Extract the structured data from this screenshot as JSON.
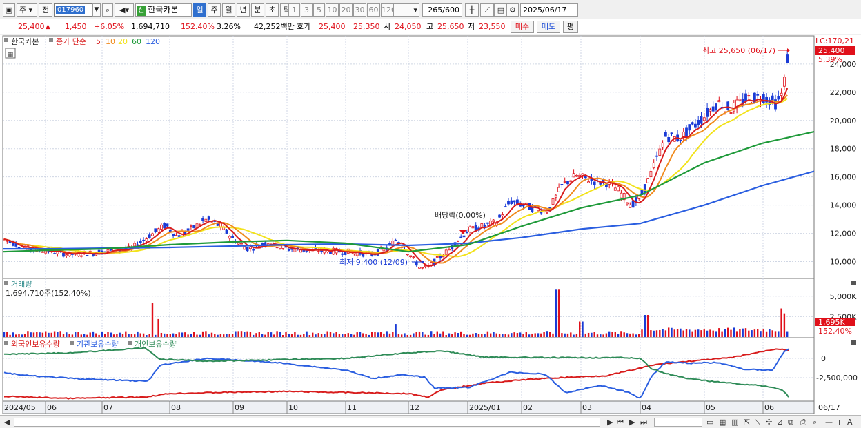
{
  "toolbar": {
    "window_icon": "window-icon",
    "market_label": "주",
    "prev_label": "전",
    "stock_code": "017960",
    "stock_badge": "신",
    "stock_name": "한국카본",
    "periods": [
      "일",
      "주",
      "월",
      "년",
      "분",
      "초",
      "틱"
    ],
    "selected_period": "일",
    "intervals": [
      "1",
      "3",
      "5",
      "10",
      "20",
      "30",
      "60",
      "120"
    ],
    "count_value": "265",
    "count_total": "/600",
    "date_value": "2025/06/17"
  },
  "quote": {
    "price": "25,400",
    "change": "1,450",
    "change_pct": "+6.05%",
    "volume": "1,694,710",
    "volume_ratio": "152.40%",
    "turnover_pct": "3.26%",
    "amount": "42,252백만",
    "ask_label": "호가",
    "ask": "25,400",
    "bid": "25,350",
    "open_label": "시",
    "open": "24,050",
    "high_label": "고",
    "high": "25,650",
    "low_label": "저",
    "low": "23,550",
    "buy_label": "매수",
    "sell_label": "매도",
    "eval_label": "평"
  },
  "price_panel": {
    "stock_name": "한국카본",
    "ma_label": "종가 단순",
    "ma_periods": [
      "5",
      "10",
      "20",
      "60",
      "120"
    ],
    "ma_colors": [
      "#d81c1c",
      "#f08a1c",
      "#f2e21a",
      "#1f9a3a",
      "#2a5ee0"
    ],
    "lc_label": "LC:170,21",
    "last_price_tag": "25,400",
    "pct_tag": "5,39%",
    "y_ticks": [
      "24,000",
      "22,000",
      "20,000",
      "18,000",
      "16,000",
      "14,000",
      "12,000",
      "10,000"
    ],
    "high_note": "최고 25,650 (06/17)",
    "low_note": "최저 9,400 (12/09)",
    "dividend_note": "배당락(0,00%)"
  },
  "volume_panel": {
    "title": "거래량",
    "value_label": "1,694,710주(152,40%)",
    "y_ticks": [
      "5,000K",
      "2,500K"
    ],
    "last_tag": "1,695K",
    "pct_tag": "152,40%"
  },
  "holder_panel": {
    "labels": [
      "외국인보유수량",
      "기관보유수량",
      "개인보유수량"
    ],
    "colors": [
      "#d81c1c",
      "#2a5ee0",
      "#2e8b57"
    ],
    "y_ticks": [
      "0",
      "-2,500,000"
    ]
  },
  "x_axis": [
    "2024/05",
    "06",
    "07",
    "08",
    "09",
    "10",
    "11",
    "12",
    "2025/01",
    "02",
    "03",
    "04",
    "05",
    "06",
    "06/17"
  ],
  "chart_data": {
    "type": "candlestick",
    "x": [
      "2024/05",
      "06",
      "07",
      "08",
      "09",
      "10",
      "11",
      "12",
      "2025/01",
      "02",
      "03",
      "04",
      "05",
      "06",
      "06/17"
    ],
    "close": [
      11600,
      10800,
      10700,
      12700,
      11400,
      10900,
      10600,
      9800,
      12300,
      13600,
      15600,
      14300,
      20300,
      21700,
      25400
    ],
    "ma120": [
      10900,
      10900,
      10950,
      11000,
      11100,
      11200,
      11250,
      11150,
      11300,
      11700,
      12300,
      12700,
      14000,
      15400,
      16400
    ],
    "ma60": [
      10700,
      10800,
      10900,
      11200,
      11400,
      11500,
      11300,
      10700,
      11200,
      12500,
      13800,
      14700,
      17000,
      18400,
      19200
    ],
    "volume_k": [
      300,
      250,
      350,
      1200,
      400,
      300,
      350,
      600,
      900,
      700,
      1100,
      900,
      1500,
      1300,
      1695
    ],
    "y_range": [
      9000,
      25800
    ],
    "y_ticks": [
      10000,
      12000,
      14000,
      16000,
      18000,
      20000,
      22000,
      24000
    ]
  }
}
